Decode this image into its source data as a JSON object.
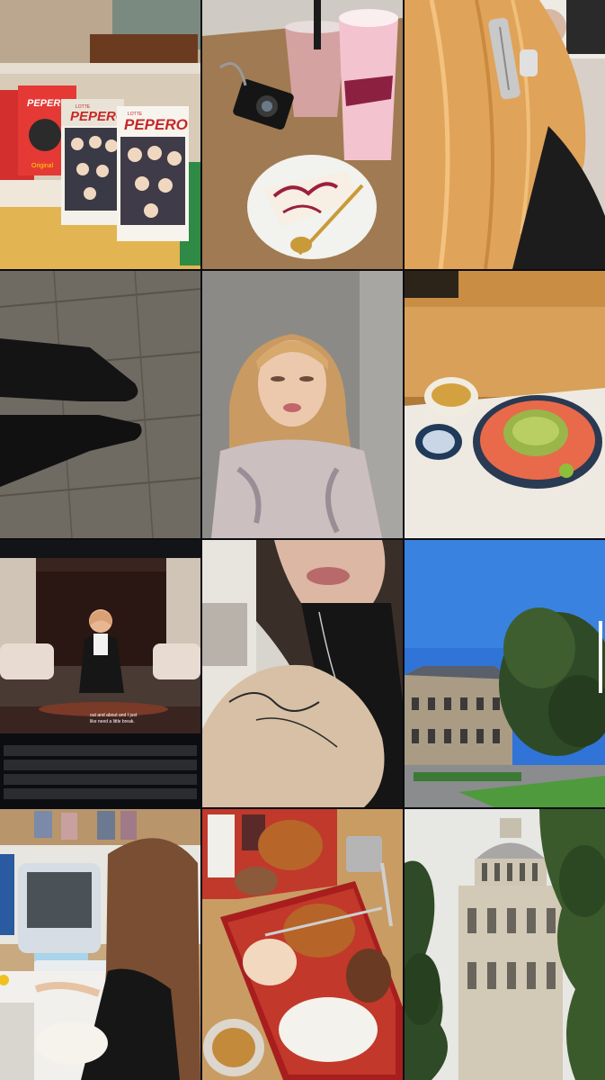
{
  "grid": {
    "columns": 3,
    "rows": 4,
    "background": "#0b0d12"
  },
  "tiles": {
    "t1": {
      "subject": "snack-shelf",
      "box_text": "PEPERO",
      "brand": "LOTTE",
      "flavor": "Original"
    },
    "t2": {
      "subject": "cafe-table"
    },
    "t3": {
      "subject": "blonde-hair-clip"
    },
    "t4": {
      "subject": "black-boots-on-floor"
    },
    "t5": {
      "subject": "blonde-selfie"
    },
    "t6": {
      "subject": "salmon-avocado-bowl"
    },
    "t7": {
      "subject": "laptop-interview",
      "subtitle_line1": "out and about and I just",
      "subtitle_line2": "like need a little break."
    },
    "t8": {
      "subject": "brunette-selfie"
    },
    "t9": {
      "subject": "parisian-courtyard"
    },
    "t10": {
      "subject": "retro-computer-desk"
    },
    "t11": {
      "subject": "bento-boxes"
    },
    "t12": {
      "subject": "domed-building"
    }
  },
  "colors": {
    "sky": "#2f74d6",
    "hair_blonde": "#e0a35a",
    "tray_red": "#c0392b",
    "foliage": "#2f4a26"
  }
}
